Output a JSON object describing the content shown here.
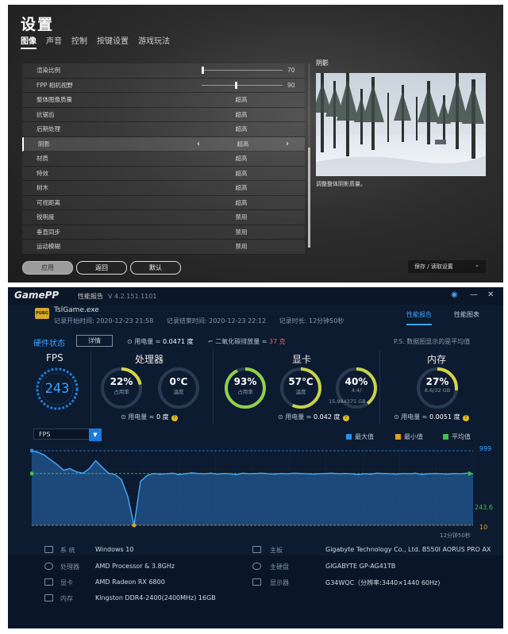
{
  "game": {
    "title": "设置",
    "tabs": [
      "图像",
      "声音",
      "控制",
      "按键设置",
      "游戏玩法"
    ],
    "rows": [
      {
        "label": "渲染比例",
        "value": "",
        "slider": 0.0,
        "number": "70"
      },
      {
        "label": "FPP 相机视野",
        "value": "",
        "slider": 0.4,
        "number": "90"
      },
      {
        "label": "整体图像质量",
        "value": "超高"
      },
      {
        "label": "抗锯齿",
        "value": "超高"
      },
      {
        "label": "后期处理",
        "value": "超高"
      },
      {
        "label": "阴影",
        "value": "超高",
        "selected": true,
        "left_arrow": "‹",
        "right_arrow": "›"
      },
      {
        "label": "材质",
        "value": "超高"
      },
      {
        "label": "特效",
        "value": "超高"
      },
      {
        "label": "树木",
        "value": "超高"
      },
      {
        "label": "可视距离",
        "value": "超高"
      },
      {
        "label": "锐明度",
        "value": "禁用"
      },
      {
        "label": "垂直同步",
        "value": "禁用"
      },
      {
        "label": "运动模糊",
        "value": "禁用"
      }
    ],
    "preview_title": "阴影",
    "preview_desc": "调整整体阴影质量。",
    "buttons": {
      "apply": "应用",
      "back": "返回",
      "default": "默认"
    },
    "save_load": "保存 / 读取设置",
    "save_chevron": "⌄"
  },
  "pp": {
    "brand": "GamePP",
    "report_title": "性能报告",
    "version": "V 4.2.151.1101",
    "window_icons": {
      "camera": "◉",
      "minimize": "—",
      "close": "✕"
    },
    "game_badge": "PUBG",
    "game_name": "TslGame.exe",
    "record_start": "记录开始时间: 2020-12-23 21:58",
    "record_end": "记录结束时间: 2020-12-23 22:12",
    "record_duration": "记录时长: 12分钟50秒",
    "tabs": {
      "report": "性能报告",
      "chart": "性能图表"
    },
    "hw_status": "硬件状态",
    "detail": "详情",
    "total_power_label": "用电量 ≈",
    "total_power_value": "0.0471 度",
    "co2_label": "二氧化碳排放量 ≈",
    "co2_value": "37 克",
    "hint": "P.S. 数据图显示的是平均值",
    "fps": {
      "label": "FPS",
      "value": "243"
    },
    "cpu": {
      "title": "处理器",
      "usage": "22%",
      "usage_label": "占用率",
      "usage_frac": 0.22,
      "temp": "0℃",
      "temp_label": "温度",
      "temp_frac": 0.0,
      "power_label": "用电量 ≈",
      "power_value": "0 度"
    },
    "gpu": {
      "title": "显卡",
      "usage": "93%",
      "usage_label": "占用率",
      "usage_frac": 0.93,
      "temp": "57℃",
      "temp_label": "温度",
      "temp_frac": 0.57,
      "mem": "40%",
      "mem_sub1": "4.4/",
      "mem_sub2": "15.984375 GB",
      "mem_frac": 0.4,
      "power_label": "用电量 ≈",
      "power_value": "0.042 度"
    },
    "ram": {
      "title": "内存",
      "usage": "27%",
      "usage_sub": "8.6/32 GB",
      "usage_frac": 0.27,
      "power_label": "用电量 ≈",
      "power_value": "0.0051 度"
    },
    "help": "?",
    "chart_select": "FPS",
    "chart_select_arrow": "▼",
    "legend": {
      "max": "最大值",
      "min": "最小值",
      "avg": "平均值"
    },
    "colors": {
      "max": "#2a8ff0",
      "min": "#e2a21f",
      "avg": "#3fc24a",
      "accent": "#3ea1ff"
    },
    "system": {
      "os_label": "系 统",
      "os": "Windows 10",
      "cpu_label": "处理器",
      "cpu": "AMD Processor & 3.8GHz",
      "gpu_label": "显卡",
      "gpu": "AMD Radeon RX 6800",
      "ram_label": "内存",
      "ram": "Kingston DDR4-2400(2400MHz) 16GB",
      "board_label": "主板",
      "board": "Gigabyte Technology Co., Ltd. B550I AORUS PRO AX",
      "disk_label": "主硬盘",
      "disk": "GIGABYTE GP-AG41TB",
      "monitor_label": "显示器",
      "monitor": "G34WQC（分辨率:3440×1440 60Hz)"
    }
  },
  "chart_data": {
    "type": "area",
    "series": [
      {
        "name": "FPS",
        "values": [
          999,
          900,
          760,
          560,
          420,
          300,
          330,
          270,
          250,
          330,
          540,
          360,
          250,
          230,
          170,
          60,
          10,
          150,
          215,
          245,
          235,
          240,
          250,
          230,
          240,
          255,
          245,
          240,
          250,
          235,
          245,
          240,
          230,
          250,
          240,
          245,
          250,
          240,
          235,
          245,
          240,
          250,
          245,
          240,
          235,
          240,
          245,
          250,
          240,
          245,
          240,
          230,
          240,
          235,
          250,
          245,
          240,
          235,
          245,
          240,
          250,
          230,
          240,
          245,
          240,
          235,
          245,
          240,
          250,
          240
        ]
      }
    ],
    "reference_lines": {
      "max": 999,
      "avg": 243.6,
      "min": 10
    },
    "y_labels": [
      "999",
      "243.6",
      "10"
    ],
    "x_end_label": "12分钟50秒",
    "ylim": [
      10,
      999
    ],
    "grid": true
  }
}
